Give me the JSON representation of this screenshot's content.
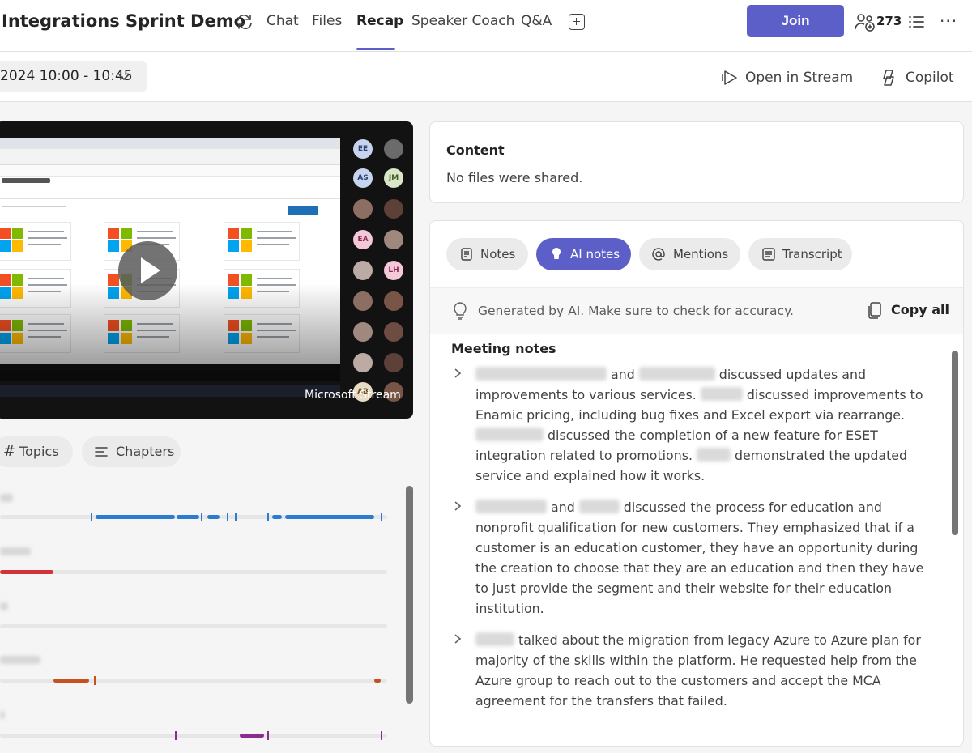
{
  "header": {
    "meeting_title": "Integrations Sprint Demo",
    "tabs": [
      {
        "label": "Chat"
      },
      {
        "label": "Files"
      },
      {
        "label": "Recap"
      },
      {
        "label": "Speaker Coach"
      },
      {
        "label": "Q&A"
      }
    ],
    "active_tab": "Recap",
    "join_label": "Join",
    "participants_count": "273"
  },
  "subbar": {
    "date_range": "2024 10:00 - 10:45",
    "open_in_stream": "Open in Stream",
    "copilot": "Copilot"
  },
  "video": {
    "watermark": "Microsoft Stream",
    "participants": [
      {
        "initials": "EE",
        "color": "#c7d4ee"
      },
      {
        "initials": "AS",
        "color": "#c7d4ee"
      },
      {
        "initials": "JM",
        "color": "#d9e6c7"
      },
      {
        "initials": "EA",
        "color": "#f3c9d9"
      },
      {
        "initials": "LH",
        "color": "#f3c9d9"
      },
      {
        "initials": "AB",
        "color": "#e8dcc4"
      }
    ]
  },
  "left_panel": {
    "topics_label": "Topics",
    "chapters_label": "Chapters",
    "speaker_tracks": [
      {
        "color": "#2b7bd1"
      },
      {
        "color": "#d13438"
      },
      {
        "color": "#cccccc"
      },
      {
        "color": "#c4511f"
      },
      {
        "color": "#8b2d8f"
      }
    ]
  },
  "content": {
    "heading": "Content",
    "empty_text": "No files were shared."
  },
  "notes": {
    "tabs": {
      "notes": "Notes",
      "ai_notes": "AI notes",
      "mentions": "Mentions",
      "transcript": "Transcript"
    },
    "disclaimer": "Generated by AI. Make sure to check for accuracy.",
    "copy_all": "Copy all",
    "section_title": "Meeting notes",
    "bullets": [
      {
        "parts": [
          " and ",
          " discussed updates and improvements to various services. ",
          " discussed improvements to Enamic pricing, including bug fixes and Excel export via rearrange. ",
          " discussed the completion of a new feature for ESET integration related to promotions. ",
          " demonstrated the updated service and explained how it works."
        ]
      },
      {
        "parts": [
          " and ",
          " discussed the process for education and nonprofit qualification for new customers. They emphasized that if a customer is an education customer, they have an opportunity during the creation to choose that they are an education and then they have to just provide the segment and their website for their education institution."
        ]
      },
      {
        "parts": [
          " talked about the migration from legacy Azure to Azure plan for majority of the skills within the platform. He requested help from the Azure group to reach out to the customers and accept the MCA agreement for the transfers that failed."
        ]
      }
    ]
  },
  "colors": {
    "brand": "#5b5fc7",
    "page_bg": "#f5f5f5"
  }
}
